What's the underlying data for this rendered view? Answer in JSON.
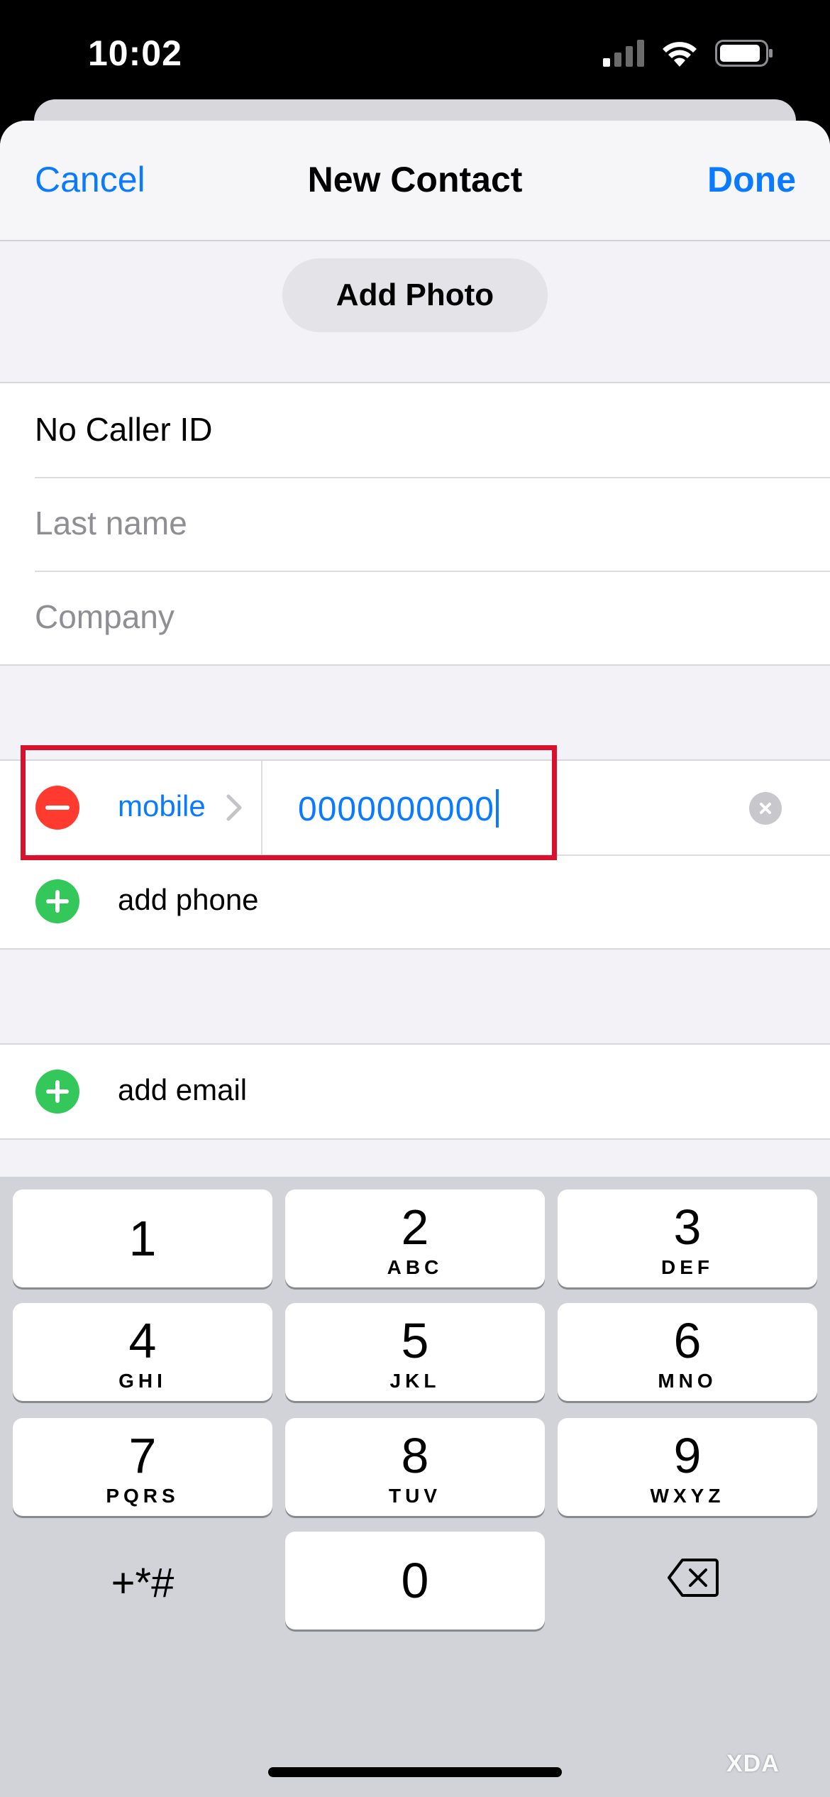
{
  "status_bar": {
    "time": "10:02"
  },
  "nav": {
    "cancel_label": "Cancel",
    "title": "New Contact",
    "done_label": "Done"
  },
  "photo": {
    "add_photo_label": "Add Photo"
  },
  "name_fields": {
    "first_name_value": "No Caller ID",
    "last_name_placeholder": "Last name",
    "company_placeholder": "Company"
  },
  "phone": {
    "label": "mobile",
    "value": "0000000000",
    "add_phone_label": "add phone"
  },
  "email": {
    "add_email_label": "add email"
  },
  "keypad": {
    "keys": [
      {
        "num": "1",
        "letters": ""
      },
      {
        "num": "2",
        "letters": "ABC"
      },
      {
        "num": "3",
        "letters": "DEF"
      },
      {
        "num": "4",
        "letters": "GHI"
      },
      {
        "num": "5",
        "letters": "JKL"
      },
      {
        "num": "6",
        "letters": "MNO"
      },
      {
        "num": "7",
        "letters": "PQRS"
      },
      {
        "num": "8",
        "letters": "TUV"
      },
      {
        "num": "9",
        "letters": "WXYZ"
      },
      {
        "num": "0",
        "letters": ""
      }
    ],
    "symbols_label": "+*#"
  },
  "watermark": {
    "text": "XDA"
  },
  "colors": {
    "accent": "#0a7aff",
    "remove": "#ff3b30",
    "add": "#34c759",
    "highlight": "#d8112f"
  }
}
